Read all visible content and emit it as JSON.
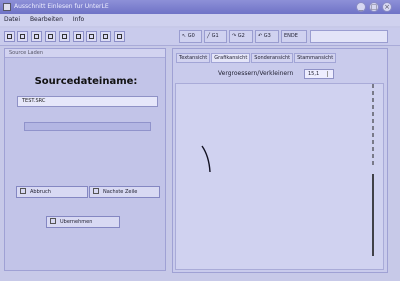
{
  "window": {
    "title": "Ausschnitt Einlesen fur UnterLE",
    "controls": [
      "_",
      "□",
      "×"
    ]
  },
  "menu": {
    "items": [
      "Datei",
      "Bearbeiten",
      "Info"
    ]
  },
  "toolbar": {
    "groups": [
      "↖ G0",
      "╱ G1",
      "↷ G2",
      "↶ G3",
      "ENDE"
    ],
    "search_value": ""
  },
  "left_panel": {
    "header": "Source Laden",
    "source_label": "Sourcedateiname:",
    "source_value": "TEST.SRC",
    "abort_label": "Abbruch",
    "next_label": "Nachste Zeile",
    "apply_label": "Ubernehmen"
  },
  "right_panel": {
    "tabs": [
      "Textansicht",
      "Grafikansicht",
      "Sonderansicht",
      "Stammansicht"
    ],
    "active_tab": 1,
    "zoom_label": "Vergroessern/Verkleinern",
    "zoom_value": "15,1"
  }
}
